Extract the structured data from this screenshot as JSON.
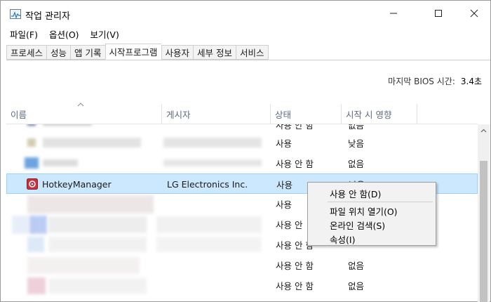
{
  "window": {
    "title": "작업 관리자"
  },
  "menu": [
    "파일(F)",
    "옵션(O)",
    "보기(V)"
  ],
  "tabs": [
    {
      "label": "프로세스",
      "active": false
    },
    {
      "label": "성능",
      "active": false
    },
    {
      "label": "앱 기록",
      "active": false
    },
    {
      "label": "시작프로그램",
      "active": true
    },
    {
      "label": "사용자",
      "active": false
    },
    {
      "label": "세부 정보",
      "active": false
    },
    {
      "label": "서비스",
      "active": false
    }
  ],
  "bios": {
    "label": "마지막 BIOS 시간:",
    "value": "3.4초"
  },
  "columns": {
    "name": "이름",
    "publisher": "게시자",
    "status": "상태",
    "impact": "시작 시 영향"
  },
  "rows": [
    {
      "name": "",
      "publisher": "",
      "status": "사용 안 함",
      "impact": "없음",
      "obscured": true
    },
    {
      "name": "",
      "publisher": "",
      "status": "사용",
      "impact": "낮음",
      "obscured": true
    },
    {
      "name": "",
      "publisher": "",
      "status": "사용 안 함",
      "impact": "없음",
      "obscured": true
    },
    {
      "name": "HotkeyManager",
      "publisher": "LG Electronics Inc.",
      "status": "사용",
      "impact": "낮음",
      "selected": true
    },
    {
      "name": "",
      "publisher": "",
      "status": "사용",
      "impact": "",
      "obscured": true
    },
    {
      "name": "",
      "publisher": "",
      "status": "사용 안",
      "impact": "",
      "obscured": true
    },
    {
      "name": "",
      "publisher": "",
      "status": "사용 안 함",
      "impact": "",
      "obscured": true
    },
    {
      "name": "",
      "publisher": "",
      "status": "사용 안 함",
      "impact": "없음",
      "obscured": true
    },
    {
      "name": "",
      "publisher": "",
      "status": "사용 안 함",
      "impact": "없음",
      "obscured": true
    }
  ],
  "context_menu": [
    "사용 안 함(D)",
    "파일 위치 열기(O)",
    "온라인 검색(S)",
    "속성(I)"
  ],
  "colors": {
    "selection": "#cce8ff",
    "selection_border": "#99d1ff",
    "header_text": "#5a6a80"
  }
}
